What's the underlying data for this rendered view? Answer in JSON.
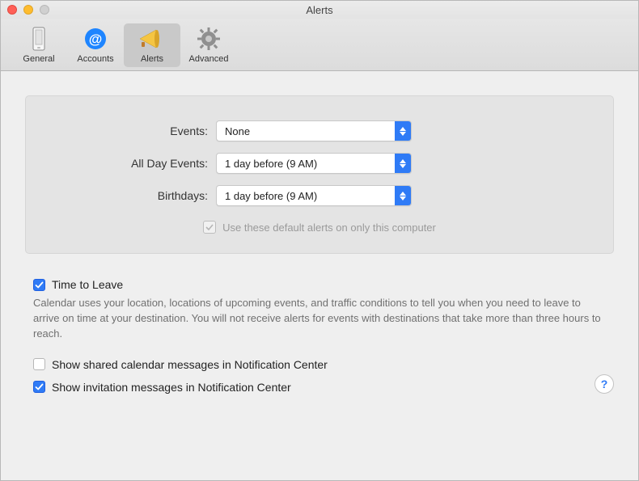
{
  "window": {
    "title": "Alerts"
  },
  "toolbar": {
    "items": [
      {
        "label": "General",
        "icon": "general-icon",
        "selected": false
      },
      {
        "label": "Accounts",
        "icon": "accounts-icon",
        "selected": false
      },
      {
        "label": "Alerts",
        "icon": "alerts-icon",
        "selected": true
      },
      {
        "label": "Advanced",
        "icon": "advanced-icon",
        "selected": false
      }
    ]
  },
  "defaults": {
    "rows": [
      {
        "label": "Events:",
        "value": "None"
      },
      {
        "label": "All Day Events:",
        "value": "1 day before (9 AM)"
      },
      {
        "label": "Birthdays:",
        "value": "1 day before (9 AM)"
      }
    ],
    "useOnly": {
      "checked": true,
      "label": "Use these default alerts on only this computer"
    }
  },
  "options": {
    "timeToLeave": {
      "checked": true,
      "label": "Time to Leave",
      "desc": "Calendar uses your location, locations of upcoming events, and traffic conditions to tell you when you need to leave to arrive on time at your destination. You will not receive alerts for events with destinations that take more than three hours to reach."
    },
    "sharedMessages": {
      "checked": false,
      "label": "Show shared calendar messages in Notification Center"
    },
    "invitationMessages": {
      "checked": true,
      "label": "Show invitation messages in Notification Center"
    }
  },
  "help": {
    "label": "?"
  }
}
